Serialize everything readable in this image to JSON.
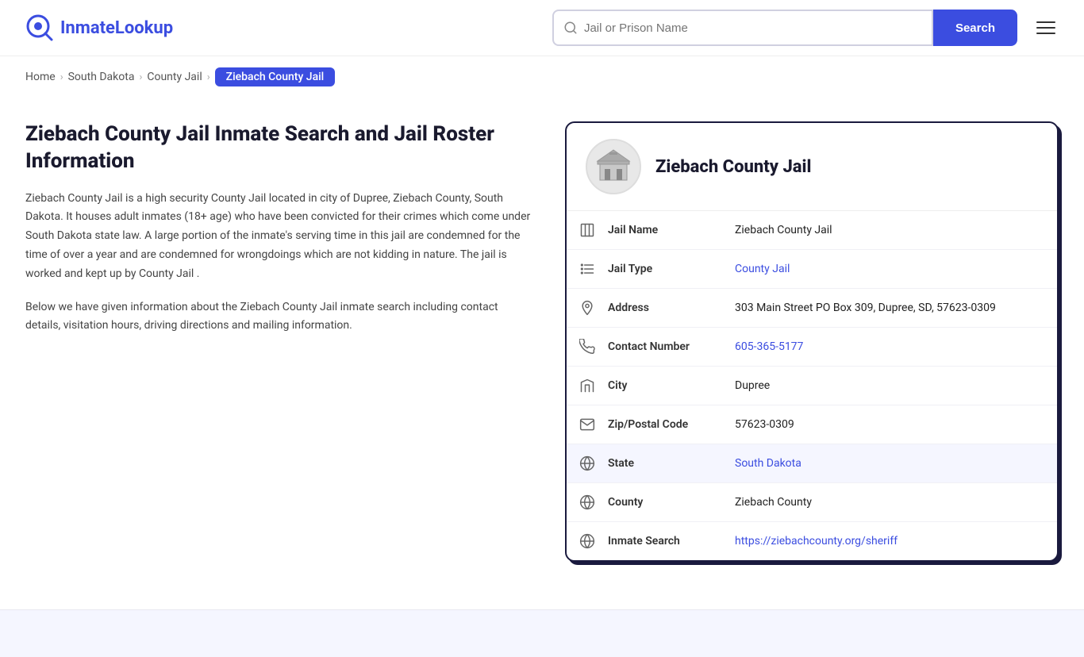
{
  "site": {
    "name_part1": "Inmate",
    "name_part2": "Lookup"
  },
  "header": {
    "search_placeholder": "Jail or Prison Name",
    "search_button_label": "Search"
  },
  "breadcrumb": {
    "home": "Home",
    "state": "South Dakota",
    "type": "County Jail",
    "current": "Ziebach County Jail"
  },
  "left": {
    "title": "Ziebach County Jail Inmate Search and Jail Roster Information",
    "description1": "Ziebach County Jail is a high security County Jail located in city of Dupree, Ziebach County, South Dakota. It houses adult inmates (18+ age) who have been convicted for their crimes which come under South Dakota state law. A large portion of the inmate's serving time in this jail are condemned for the time of over a year and are condemned for wrongdoings which are not kidding in nature. The jail is worked and kept up by County Jail .",
    "description2": "Below we have given information about the Ziebach County Jail inmate search including contact details, visitation hours, driving directions and mailing information."
  },
  "card": {
    "jail_name_display": "Ziebach County Jail",
    "rows": [
      {
        "label": "Jail Name",
        "value": "Ziebach County Jail",
        "link": null,
        "icon": "jail-icon",
        "highlighted": false
      },
      {
        "label": "Jail Type",
        "value": "County Jail",
        "link": "#",
        "icon": "list-icon",
        "highlighted": false
      },
      {
        "label": "Address",
        "value": "303 Main Street PO Box 309, Dupree, SD, 57623-0309",
        "link": null,
        "icon": "location-icon",
        "highlighted": false
      },
      {
        "label": "Contact Number",
        "value": "605-365-5177",
        "link": "tel:6053655177",
        "icon": "phone-icon",
        "highlighted": false
      },
      {
        "label": "City",
        "value": "Dupree",
        "link": null,
        "icon": "city-icon",
        "highlighted": false
      },
      {
        "label": "Zip/Postal Code",
        "value": "57623-0309",
        "link": null,
        "icon": "mail-icon",
        "highlighted": false
      },
      {
        "label": "State",
        "value": "South Dakota",
        "link": "#",
        "icon": "globe-icon",
        "highlighted": true
      },
      {
        "label": "County",
        "value": "Ziebach County",
        "link": null,
        "icon": "county-icon",
        "highlighted": false
      },
      {
        "label": "Inmate Search",
        "value": "https://ziebachcounty.org/sheriff",
        "link": "https://ziebachcounty.org/sheriff",
        "icon": "search-globe-icon",
        "highlighted": false
      }
    ]
  }
}
